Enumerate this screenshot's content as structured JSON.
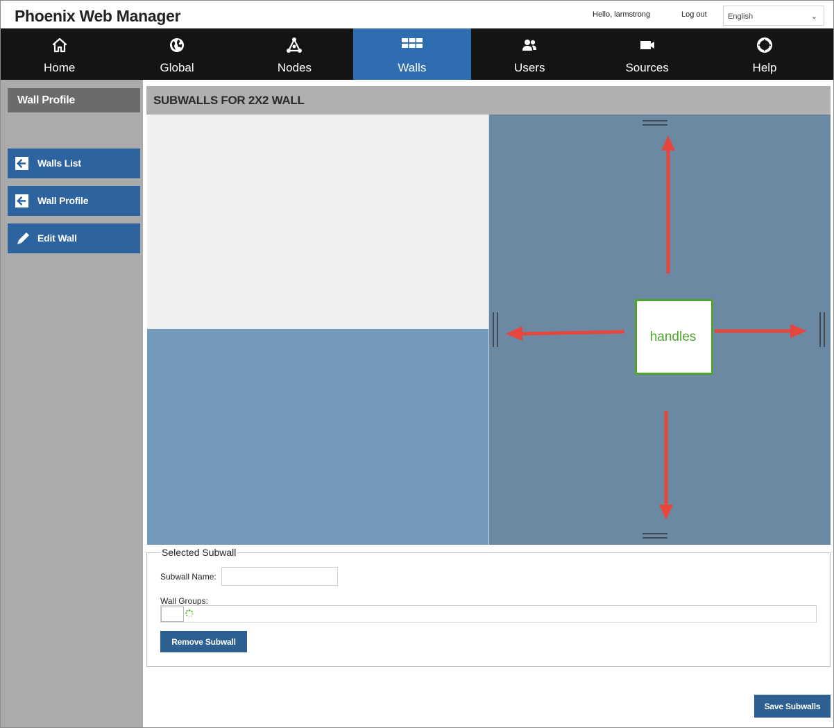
{
  "header": {
    "app_title": "Phoenix Web Manager",
    "greeting": "Hello, larmstrong",
    "logout_label": "Log out",
    "language": "English"
  },
  "nav": {
    "items": [
      {
        "label": "Home",
        "icon": "home-icon"
      },
      {
        "label": "Global",
        "icon": "globe-icon"
      },
      {
        "label": "Nodes",
        "icon": "nodes-icon"
      },
      {
        "label": "Walls",
        "icon": "grid-icon",
        "active": true
      },
      {
        "label": "Users",
        "icon": "users-icon"
      },
      {
        "label": "Sources",
        "icon": "camera-icon"
      },
      {
        "label": "Help",
        "icon": "lifebuoy-icon"
      }
    ],
    "active_color": "#2d6db0"
  },
  "sidebar": {
    "title": "Wall Profile",
    "buttons": [
      {
        "label": "Walls List",
        "icon": "arrow-left-icon"
      },
      {
        "label": "Wall Profile",
        "icon": "arrow-left-icon"
      },
      {
        "label": "Edit Wall",
        "icon": "pencil-icon"
      }
    ]
  },
  "content": {
    "title": "SUBWALLS FOR 2X2 WALL",
    "annotation": "handles"
  },
  "selected_subwall": {
    "legend": "Selected Subwall",
    "name_label": "Subwall Name:",
    "name_value": "",
    "groups_label": "Wall Groups:",
    "remove_label": "Remove Subwall"
  },
  "footer": {
    "save_label": "Save Subwalls"
  },
  "colors": {
    "nav_bg": "#141414",
    "button_blue": "#2d5f90",
    "arrow_red": "#e5473c",
    "annotation_green": "#4ea42d"
  }
}
